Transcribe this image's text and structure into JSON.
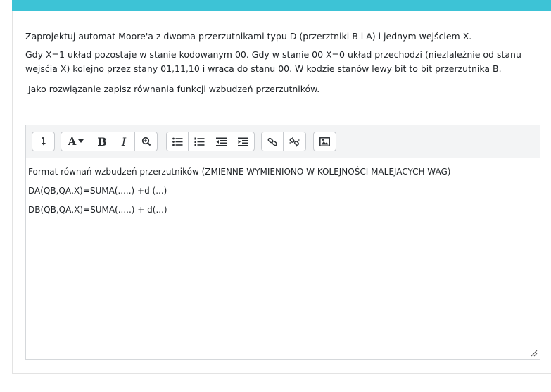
{
  "question": {
    "line1": "Zaprojektuj automat Moore'a z dwoma przerzutnikami typu D  (przerztniki B i A) i jednym wejściem X.",
    "line2": "Gdy X=1 układ pozostaje w stanie  kodowanym  00. Gdy w stanie 00  X=0  układ przechodzi (niezlależnie od stanu wejsćia X) kolejno przez stany 01,11,10 i wraca do stanu 00. W kodzie stanów lewy bit to bit przerzutnika B.",
    "line3": "Jako rozwiązanie zapisz równania funkcji wzbudzeń przerzutników."
  },
  "toolbar": {
    "collapse_icon": "arrow-down-icon",
    "font_label": "A",
    "bold_label": "B",
    "italic_label": "I",
    "icons": [
      "accessibility-checker-icon",
      "unordered-list-icon",
      "ordered-list-icon",
      "outdent-icon",
      "indent-icon",
      "link-icon",
      "unlink-icon",
      "image-icon"
    ]
  },
  "editor": {
    "lines": [
      "Format równań wzbudzeń przerzutników (ZMIENNE WYMIENIONO W KOLEJNOŚCI MALEJACYCH WAG)",
      "DA(QB,QA,X)=SUMA(.....) +d (...)",
      "DB(QB,QA,X)=SUMA(.....) + d(...)"
    ]
  },
  "colors": {
    "accent_bar": "#3dc3d6",
    "toolbar_bg": "#f3f4f5",
    "border": "#d5d8db"
  }
}
